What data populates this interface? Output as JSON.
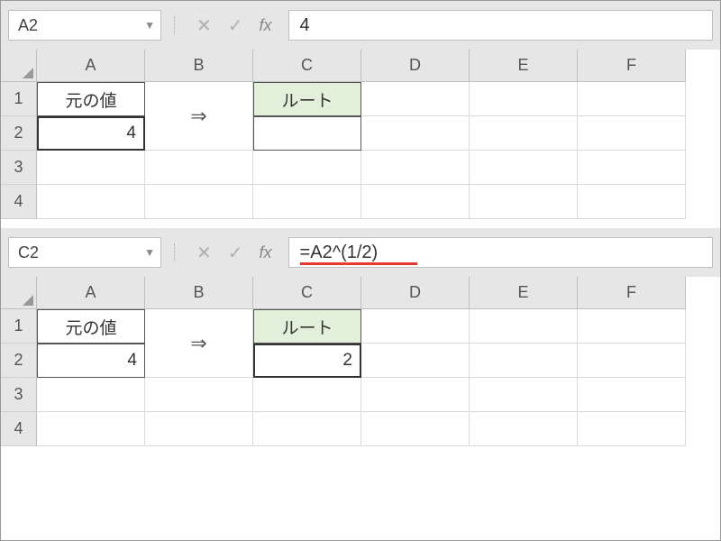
{
  "top": {
    "nameBox": "A2",
    "formula": "4",
    "underline": false,
    "columns": [
      "A",
      "B",
      "C",
      "D",
      "E",
      "F"
    ],
    "rows": [
      "1",
      "2",
      "3",
      "4"
    ],
    "cells": {
      "A1": "元の値",
      "A2": "4",
      "B12arrow": "⇒",
      "C1": "ルート",
      "C2": ""
    }
  },
  "bottom": {
    "nameBox": "C2",
    "formula": "=A2^(1/2)",
    "underline": true,
    "columns": [
      "A",
      "B",
      "C",
      "D",
      "E",
      "F"
    ],
    "rows": [
      "1",
      "2",
      "3",
      "4"
    ],
    "cells": {
      "A1": "元の値",
      "A2": "4",
      "B12arrow": "⇒",
      "C1": "ルート",
      "C2": "2"
    }
  },
  "fxLabel": "fx"
}
